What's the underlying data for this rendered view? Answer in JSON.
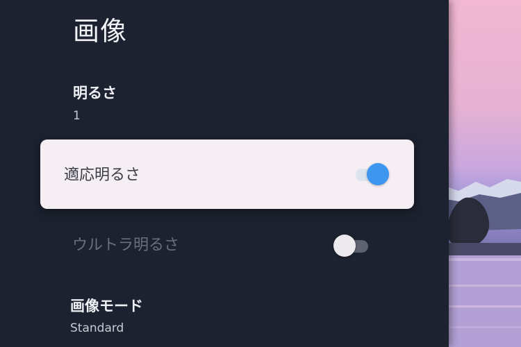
{
  "panel": {
    "title": "画像"
  },
  "settings": {
    "brightness": {
      "label": "明るさ",
      "value": "1"
    },
    "adaptive_brightness": {
      "label": "適応明るさ",
      "enabled": true
    },
    "ultra_brightness": {
      "label": "ウルトラ明るさ",
      "enabled": false
    },
    "picture_mode": {
      "label": "画像モード",
      "value": "Standard"
    }
  },
  "colors": {
    "panel_bg": "#1d2230",
    "focus_card": "#f5eef3",
    "toggle_on": "#3d97ee",
    "toggle_off_knob": "#eceaec"
  }
}
